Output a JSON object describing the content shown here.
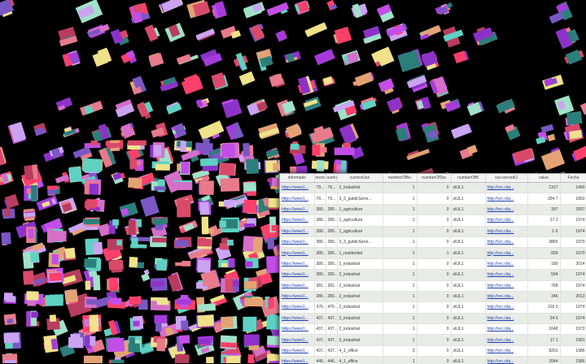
{
  "map": {
    "background": "#000000",
    "palette": [
      "#a63bdb",
      "#c24ee6",
      "#8d32c9",
      "#d56fc9",
      "#e87a8c",
      "#d94a6a",
      "#b83c5e",
      "#ff3f6b",
      "#e3a374",
      "#7a57c4",
      "#5fd1c2",
      "#9fe1c9",
      "#2b7f7a",
      "#caa4f0",
      "#f0e28a"
    ]
  },
  "attribute_table": {
    "columns": [
      "informatio",
      "nreor",
      "usefu",
      "currentUse",
      "numberOfBu",
      "numberOfDw",
      "numberOfB",
      "sus.servedU",
      "value",
      "Fecha"
    ],
    "rows": [
      [
        "https://www1...",
        "79...",
        "79...",
        "2_industrial",
        "1",
        "0",
        "sIUL1",
        "http://orc.cita...",
        "1317",
        "1490"
      ],
      [
        "https://www1...",
        "79...",
        "79...",
        "3_3_publicServi...",
        "1",
        "0",
        "sIUL1",
        "http://orc.cita...",
        "254 7",
        "1850"
      ],
      [
        "https://www1...",
        "380...",
        "280...",
        "1_agriculture",
        "1",
        "0",
        "sIUL1",
        "http://orc.cita...",
        "397",
        "2007"
      ],
      [
        "https://www1...",
        "380...",
        "280...",
        "1_agriculture",
        "1",
        "0",
        "sIUL1",
        "http://orc.cita...",
        "17 2",
        "1974"
      ],
      [
        "https://www1...",
        "380...",
        "280...",
        "1_agriculture",
        "1",
        "0",
        "sIUL1",
        "http://orc.cita...",
        "1-5",
        "1974"
      ],
      [
        "https://www1...",
        "380...",
        "280...",
        "3_3_publicServi...",
        "1",
        "0",
        "sIUL1",
        "http://orc.cita...",
        "3865",
        "1970"
      ],
      [
        "https://www1...",
        "380...",
        "280...",
        "1_residential",
        "1",
        "1",
        "sIUL1",
        "http://orc.cita...",
        "839",
        "1970"
      ],
      [
        "https://www1...",
        "380...",
        "280...",
        "2_industrial",
        "1",
        "0",
        "sIUL1",
        "http://orc.cita...",
        "189",
        "2014"
      ],
      [
        "https://www1...",
        "380...",
        "280...",
        "2_industrial",
        "1",
        "0",
        "sIUL1",
        "http://orc.cita...",
        "594",
        "1974"
      ],
      [
        "https://www1...",
        "381...",
        "281...",
        "2_industrial",
        "1",
        "0",
        "sIUL1",
        "http://orc.cita...",
        "768",
        "1974"
      ],
      [
        "https://www1...",
        "380...",
        "280...",
        "2_industrial",
        "1",
        "0",
        "sIUL1",
        "http://orc.cita...",
        "346",
        "2013"
      ],
      [
        "https://www1...",
        "376...",
        "476...",
        "2_industrial",
        "1",
        "0",
        "sIUL1",
        "http://orc.cita...",
        "103 9",
        "1974"
      ],
      [
        "https://www1...",
        "437...",
        "437...",
        "2_industrial",
        "1",
        "0",
        "sIUL1",
        "http://orc.cita...",
        "24 5",
        "1974"
      ],
      [
        "https://www1...",
        "437...",
        "437...",
        "2_industrial",
        "1",
        "0",
        "sIUL1",
        "http://orc.cita...",
        "1648",
        "1973"
      ],
      [
        "https://www1...",
        "437...",
        "437...",
        "2_industrial",
        "1",
        "0",
        "sIUL1",
        "http://orc.cita...",
        "17 1",
        "1991"
      ],
      [
        "https://www1...",
        "437...",
        "437...",
        "4_1_office",
        "3",
        "0",
        "sIUL1",
        "http://orc.cita...",
        "8201",
        "1986"
      ],
      [
        "https://www1...",
        "446...",
        "446...",
        "4_1_office",
        "1",
        "0",
        "sIUL1",
        "http://orc.cita...",
        "2044",
        "1986"
      ]
    ]
  }
}
